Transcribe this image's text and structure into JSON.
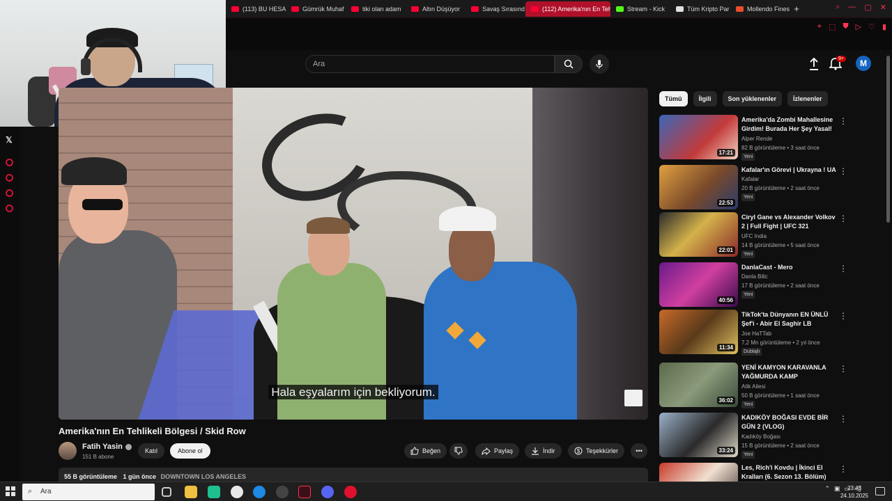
{
  "browser": {
    "tabs": [
      {
        "label": "(113) BU HESA"
      },
      {
        "label": "Gümrük Muhaf"
      },
      {
        "label": "tiki olan adam"
      },
      {
        "label": "Altın Düşüyor"
      },
      {
        "label": "Savaş Sırasınd"
      },
      {
        "label": "(112) Amerika'nın En Tehl"
      },
      {
        "label": "Stream - Kick"
      },
      {
        "label": "Tüm Kripto Par"
      },
      {
        "label": "Mollendo Fines"
      }
    ],
    "new_tab": "+"
  },
  "header": {
    "search_placeholder": "Ara",
    "notif_count": "9+",
    "avatar_letter": "M"
  },
  "video": {
    "subtitle": "Hala eşyalarım için bekliyorum.",
    "title": "Amerika'nın En Tehlikeli Bölgesi / Skid Row",
    "channel": "Fatih Yasin",
    "subscribers": "151 B abone",
    "join_label": "Katıl",
    "subscribe_label": "Abone ol",
    "like_label": "Beğen",
    "share_label": "Paylaş",
    "download_label": "İndir",
    "thanks_label": "Teşekkürler",
    "more_label": "•••",
    "views": "55 B görüntüleme",
    "date": "1 gün önce",
    "tag": "DOWNTOWN LOS ANGELES"
  },
  "chips": [
    "Tümü",
    "İlgili",
    "Son yüklenenler",
    "İzlenenler"
  ],
  "recommendations": [
    {
      "title": "Amerika'da Zombi Mahallesine Girdim! Burada Her Şey Yasal! ...",
      "channel": "Alper Rende",
      "meta": "82 B görüntüleme • 3 saat önce",
      "badge": "Yeni",
      "duration": "17:21"
    },
    {
      "title": "Kafalar'ın Görevi | Ukrayna ! UA",
      "channel": "Kafalar",
      "meta": "20 B görüntüleme • 2 saat önce",
      "badge": "Yeni",
      "duration": "22:53"
    },
    {
      "title": "Ciryl Gane vs Alexander Volkov 2 | Full Fight | UFC 321",
      "channel": "UFC India",
      "meta": "14 B görüntüleme • 5 saat önce",
      "badge": "Yeni",
      "duration": "22:01"
    },
    {
      "title": "DanlaCast - Mero",
      "channel": "Danla Bilic",
      "meta": "17 B görüntüleme • 2 saat önce",
      "badge": "Yeni",
      "duration": "40:56"
    },
    {
      "title": "TikTok'ta Dünyanın EN ÜNLÜ Şef'i - Abir El Saghir LB",
      "channel": "Joe HaTTab",
      "meta": "7,2 Mn görüntüleme • 2 yıl önce",
      "badge": "Dublajlı",
      "duration": "11:34"
    },
    {
      "title": "YENİ KAMYON KARAVANLA YAĞMURDA KAMP",
      "channel": "Atik Ailesi",
      "meta": "50 B görüntüleme • 1 saat önce",
      "badge": "Yeni",
      "duration": "36:02"
    },
    {
      "title": "KADIKÖY BOĞASI EVDE BİR GÜN 2 (VLOG)",
      "channel": "Kadıköy Boğası",
      "meta": "15 B görüntüleme • 2 saat önce",
      "badge": "Yeni",
      "duration": "33:24"
    },
    {
      "title": "Les, Rich'i Kovdu | İkinci El Kralları (6. Sezon 13. Bölüm)",
      "channel": "",
      "meta": "",
      "badge": "",
      "duration": ""
    }
  ],
  "taskbar": {
    "search_placeholder": "Ara",
    "time": "23:43",
    "date": "24.10.2025"
  },
  "colors": {
    "accent": "#ff0033",
    "browser_accent": "#d01438",
    "background": "#0f0f0f"
  },
  "icons": [
    "search-icon",
    "mic-icon",
    "upload-icon",
    "bell-icon",
    "like-icon",
    "dislike-icon",
    "share-icon",
    "download-icon",
    "thanks-icon",
    "kebab-icon",
    "x-icon",
    "windows-icon"
  ]
}
